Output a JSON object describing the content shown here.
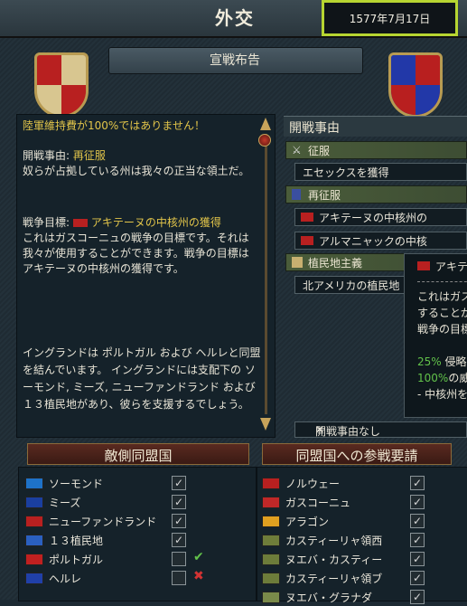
{
  "header": {
    "title": "外交",
    "date": "1577年7月17日"
  },
  "ribbon": {
    "title": "宣戦布告"
  },
  "left_panel": {
    "warning": "陸軍維持費が100%ではありません！",
    "cb_label": "開戦事由: ",
    "cb_value": "再征服",
    "cb_desc": "奴らが占拠している州は我々の正当な領土だ。",
    "goal_label": "戦争目標: ",
    "goal_value": "アキテーヌの中核州の獲得",
    "goal_desc": "これはガスコーニュの戦争の目標です。それは我々が使用することができます。戦争の目標はアキテーヌの中核州の獲得です。",
    "alliance_text": "イングランドは ポルトガル および ヘルレと同盟を結んでいます。 イングランドには支配下の ソーモンド, ミーズ, ニューファンドランド および １３植民地があり、彼らを支援するでしょう。"
  },
  "cb_panel": {
    "header": "開戦事由",
    "groups": [
      {
        "label": "征服",
        "icon": "crossed-swords-icon",
        "items": [
          "エセックスを獲得"
        ]
      },
      {
        "label": "再征服",
        "icon": "banner-icon",
        "items": [
          "アキテーヌの中核州の",
          "アルマニャックの中核"
        ]
      },
      {
        "label": "植民地主義",
        "icon": "map-icon",
        "items": [
          "北アメリカの植民地"
        ]
      }
    ],
    "no_cb": "開戦事由なし"
  },
  "tooltip": {
    "title": "アキテ",
    "line1": "これはガス",
    "line2": "することが",
    "line3": "戦争の目標",
    "pct1": "25%",
    "pct1_text": "侵略",
    "pct2": "100%",
    "pct2_text": "の威",
    "bullet": "- 中核州を"
  },
  "enemy_allies": {
    "title": "敵側同盟国",
    "rows": [
      {
        "name": "ソーモンド",
        "checked": true,
        "mark": ""
      },
      {
        "name": "ミーズ",
        "checked": true,
        "mark": ""
      },
      {
        "name": "ニューファンドランド",
        "checked": true,
        "mark": ""
      },
      {
        "name": "１３植民地",
        "checked": true,
        "mark": ""
      },
      {
        "name": "ポルトガル",
        "checked": false,
        "mark": "✔"
      },
      {
        "name": "ヘルレ",
        "checked": false,
        "mark": "✖"
      }
    ]
  },
  "our_allies": {
    "title": "同盟国への参戦要請",
    "rows": [
      {
        "name": "ノルウェー",
        "checked": true
      },
      {
        "name": "ガスコーニュ",
        "checked": true
      },
      {
        "name": "アラゴン",
        "checked": true
      },
      {
        "name": "カスティーリャ領西",
        "checked": true
      },
      {
        "name": "ヌエバ・カスティー",
        "checked": true
      },
      {
        "name": "カスティーリャ領ブ",
        "checked": true
      },
      {
        "name": "ヌエバ・グラナダ",
        "checked": true
      }
    ]
  },
  "colors": {
    "accent": "#e2c54a",
    "highlight": "#b7d531",
    "green": "#62c24a",
    "red": "#d33333"
  }
}
